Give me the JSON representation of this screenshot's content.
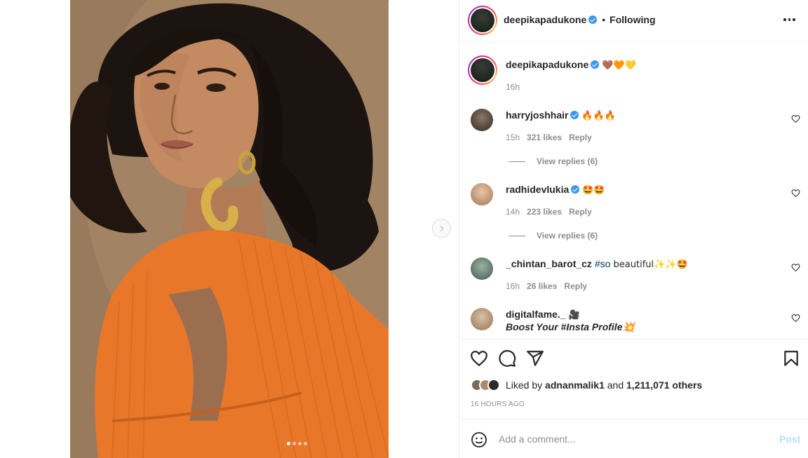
{
  "post": {
    "author": "deepikapadukone",
    "separator": "•",
    "follow_status": "Following",
    "caption_time": "16h",
    "caption_emojis": "🤎🧡💛"
  },
  "comments": [
    {
      "user": "harryjoshhair",
      "verified": true,
      "text": "🔥🔥🔥",
      "time": "15h",
      "likes": "321 likes",
      "reply": "Reply",
      "view_replies": "View replies (6)"
    },
    {
      "user": "radhidevlukia",
      "verified": true,
      "text": "🤩🤩",
      "time": "14h",
      "likes": "223 likes",
      "reply": "Reply",
      "view_replies": "View replies (6)"
    },
    {
      "user": "_chintan_barot_cz",
      "verified": false,
      "hashtag": "#so",
      "text": " beautiful✨✨🤩",
      "time": "16h",
      "likes": "26 likes",
      "reply": "Reply"
    },
    {
      "user": "digitalfame._",
      "verified": false,
      "text": "🎥",
      "line2": "Boost Your #Insta Profile💥"
    }
  ],
  "likes": {
    "prefix": "Liked by",
    "liker": "adnanmalik1",
    "connector": "and",
    "others": "1,211,071 others"
  },
  "timestamp": "16 HOURS AGO",
  "add_comment": {
    "placeholder": "Add a comment...",
    "post_label": "Post"
  },
  "icons": {
    "verified": "verified-badge-icon",
    "more": "more-options-icon",
    "next": "chevron-right-icon",
    "like": "heart-icon",
    "comment": "comment-bubble-icon",
    "share": "paper-plane-icon",
    "save": "bookmark-icon",
    "emoji": "smiley-icon"
  },
  "carousel": {
    "total": 4,
    "active_index": 0
  },
  "colors": {
    "verified_blue": "#3897f0",
    "hashtag": "#00376b",
    "post_button_disabled": "#b2dffc",
    "dress_orange": "#e8772a",
    "meta_gray": "#8e8e8e"
  }
}
